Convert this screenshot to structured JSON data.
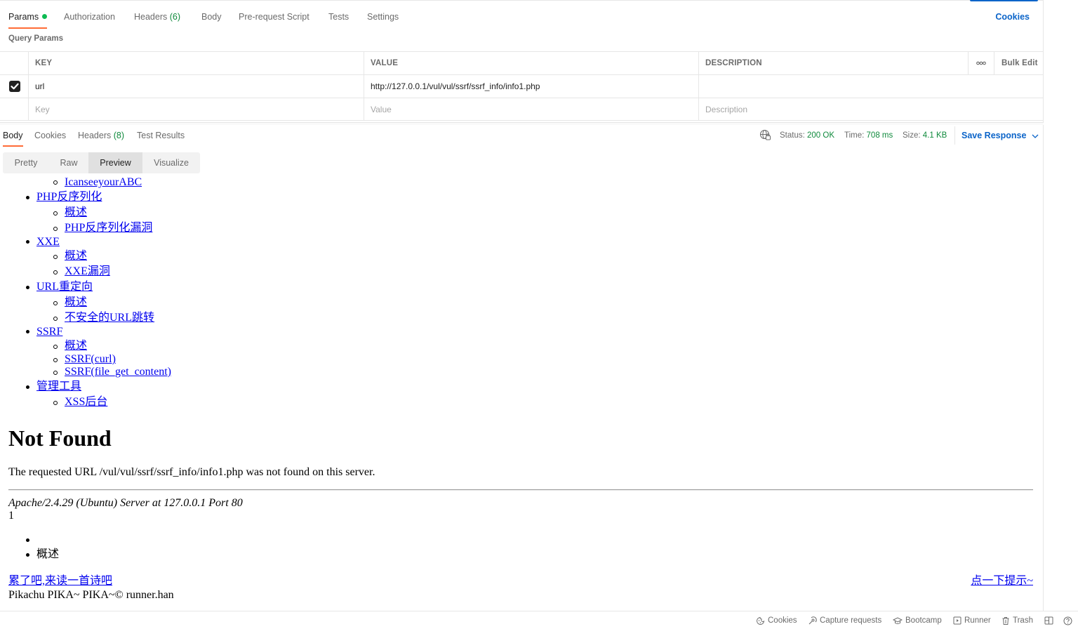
{
  "request_tabs": {
    "params": "Params",
    "authorization": "Authorization",
    "headers": "Headers",
    "headers_count": "(6)",
    "body": "Body",
    "prerequest": "Pre-request Script",
    "tests": "Tests",
    "settings": "Settings",
    "cookies": "Cookies"
  },
  "query_params": {
    "label": "Query Params",
    "columns": {
      "key": "KEY",
      "value": "VALUE",
      "description": "DESCRIPTION",
      "bulk_edit": "Bulk Edit"
    },
    "rows": [
      {
        "checked": true,
        "key": "url",
        "value": "http://127.0.0.1/vul/vul/ssrf/ssrf_info/info1.php",
        "description": ""
      }
    ],
    "placeholders": {
      "key": "Key",
      "value": "Value",
      "description": "Description"
    }
  },
  "response": {
    "tabs": {
      "body": "Body",
      "cookies": "Cookies",
      "headers": "Headers",
      "headers_count": "(8)",
      "test_results": "Test Results"
    },
    "status_label": "Status:",
    "status_value": "200 OK",
    "time_label": "Time:",
    "time_value": "708 ms",
    "size_label": "Size:",
    "size_value": "4.1 KB",
    "save_response": "Save Response",
    "view_tabs": {
      "pretty": "Pretty",
      "raw": "Raw",
      "preview": "Preview",
      "visualize": "Visualize"
    }
  },
  "preview": {
    "cut_item": "IcanseeyourABC",
    "sections": [
      {
        "title": "PHP反序列化",
        "items": [
          "概述",
          "PHP反序列化漏洞"
        ]
      },
      {
        "title": "XXE",
        "items": [
          "概述",
          "XXE漏洞"
        ]
      },
      {
        "title": "URL重定向",
        "items": [
          "概述",
          "不安全的URL跳转"
        ]
      },
      {
        "title": "SSRF",
        "items": [
          "概述",
          "SSRF(curl)",
          "SSRF(file_get_content)"
        ]
      },
      {
        "title": "管理工具",
        "items": [
          "XSS后台"
        ]
      }
    ],
    "not_found_title": "Not Found",
    "not_found_text": "The requested URL /vul/vul/ssrf/ssrf_info/info1.php was not found on this server.",
    "server_sig": "Apache/2.4.29 (Ubuntu) Server at 127.0.0.1 Port 80",
    "number": "1",
    "list_item": "概述",
    "poem_link": "累了吧,来读一首诗吧",
    "hint_link": "点一下提示~",
    "footer": "Pikachu PIKA~ PIKA~© runner.han"
  },
  "statusbar": {
    "cookies": "Cookies",
    "capture": "Capture requests",
    "bootcamp": "Bootcamp",
    "runner": "Runner",
    "trash": "Trash"
  },
  "icons": [
    "check-icon",
    "more-dots-icon",
    "globe-icon",
    "chevron-down-icon",
    "cookie-icon",
    "capture-icon",
    "bootcamp-icon",
    "runner-icon",
    "trash-icon",
    "two-pane-icon",
    "help-icon"
  ]
}
